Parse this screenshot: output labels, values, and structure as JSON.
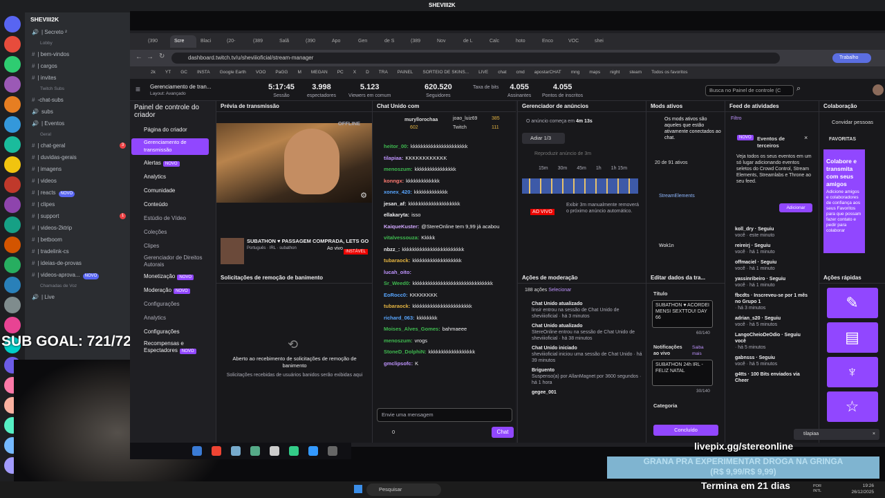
{
  "window_title": "SHEVIII2K",
  "discord": {
    "server_name": "SHEVIII2K",
    "channels": [
      {
        "type": "voice",
        "label": "| Secreto ²"
      },
      {
        "type": "category",
        "label": "Lobby"
      },
      {
        "type": "text",
        "label": "| bem-vindos"
      },
      {
        "type": "text",
        "label": "| cargos"
      },
      {
        "type": "text",
        "label": "| invites"
      },
      {
        "type": "category",
        "label": "Twitch Subs"
      },
      {
        "type": "text",
        "label": "-chat-subs"
      },
      {
        "type": "voice",
        "label": "subs"
      },
      {
        "type": "voice",
        "label": "| Eventos"
      },
      {
        "type": "category",
        "label": "Geral"
      },
      {
        "type": "text",
        "label": "| chat-geral",
        "badge": "3"
      },
      {
        "type": "text",
        "label": "| duvidas-gerais"
      },
      {
        "type": "text",
        "label": "| imagens"
      },
      {
        "type": "text",
        "label": "| videos"
      },
      {
        "type": "text",
        "label": "| reacts",
        "tag": "NOVO"
      },
      {
        "type": "text",
        "label": "| clipes"
      },
      {
        "type": "text",
        "label": "| support",
        "badge": "1"
      },
      {
        "type": "text",
        "label": "| videos-2ktrip"
      },
      {
        "type": "text",
        "label": "| betboom"
      },
      {
        "type": "text",
        "label": "| tradelink-cs"
      },
      {
        "type": "text",
        "label": "| ideias-de-provas"
      },
      {
        "type": "text",
        "label": "| videos-aprova...",
        "tag": "NOVO"
      },
      {
        "type": "category",
        "label": "Chamadas de Voz"
      },
      {
        "type": "voice",
        "label": "| Live"
      }
    ]
  },
  "overlay": {
    "sub_goal": "SUB GOAL: 721/722",
    "livepix": "livepix.gg/stereonline",
    "banner_line1": "GRANA PRA EXPERIMENTAR DROGA NA GRINGA",
    "banner_line2": "(R$ 9,99/R$ 9,99)",
    "countdown": "Termina em 21 dias"
  },
  "browser": {
    "url": "dashboard.twitch.tv/u/sheviiioficial/stream-manager",
    "tabs": [
      "(390",
      "Scre",
      "Blaci",
      "(20-",
      "(389",
      "Salã",
      "(390",
      "Apo",
      "Gen",
      "de S",
      "(389",
      "Nov",
      "de L",
      "Calc",
      "hoto",
      "Enco",
      "VOC",
      "shei"
    ],
    "active_tab": "",
    "bookmarks": [
      "2k",
      "YT",
      "GC",
      "INSTA",
      "Google Earth",
      "VOO",
      "PaGG",
      "M",
      "MEGAN",
      "PC",
      "X",
      "D",
      "TRA",
      "PAINEL",
      "SORTEIO DE SKINS...",
      "LIVE",
      "chat",
      "cmd",
      "apostarCHAT",
      "mng",
      "maps",
      "night",
      "steam",
      "Todos os favoritos"
    ],
    "profile": "Trabalho"
  },
  "twitch_header": {
    "title": "Gerenciamento de tran...",
    "subtitle": "Layout: Avançado",
    "stats": [
      {
        "value": "5:17:45",
        "label": "Sessão"
      },
      {
        "value": "3.998",
        "label": "espectadores"
      },
      {
        "value": "5.123",
        "label": "Viewers em comum"
      },
      {
        "value": "620.520",
        "label": "Seguidores"
      },
      {
        "value": "",
        "label": "Taxa de bits"
      },
      {
        "value": "4.055",
        "label": "Assinantes"
      },
      {
        "value": "4.055",
        "label": "Pontos de inscritos"
      }
    ],
    "search_placeholder": "Busca no Painel de controle (C"
  },
  "sidenav": {
    "title": "Painel de controle do criador",
    "items": [
      {
        "label": "Página do criador"
      },
      {
        "label": "Gerenciamento de transmissão",
        "active": true
      },
      {
        "label": "Alertas",
        "tag": "NOVO"
      },
      {
        "label": "Analytics"
      },
      {
        "label": "Comunidade"
      },
      {
        "label": "Conteúdo"
      },
      {
        "label": "Estúdio de Vídeo",
        "sub": true
      },
      {
        "label": "Coleções",
        "sub": true
      },
      {
        "label": "Clipes",
        "sub": true
      },
      {
        "label": "Gerenciador de Direitos Autorais",
        "sub": true
      },
      {
        "label": "Monetização",
        "tag": "NOVO"
      },
      {
        "label": "Moderação",
        "tag": "NOVO"
      },
      {
        "label": "Configurações",
        "sub": true
      },
      {
        "label": "Analytics",
        "sub": true
      },
      {
        "label": "Configurações"
      },
      {
        "label": "Recompensas e Espectadores",
        "tag": "NOVO"
      }
    ]
  },
  "preview": {
    "header": "Prévia de transmissão",
    "status": "OFFLINE",
    "stream_title": "SUBATHON ♥ PASSAGEM COMPRADA, LETS GO",
    "tags": [
      "Português",
      "IRL",
      "subathon"
    ],
    "ao_vivo": "Ao vivo",
    "instavel": "INSTÁVEL"
  },
  "ban_requests": {
    "header": "Solicitações de remoção de banimento",
    "empty_title": "Aberto ao recebimento de solicitações de remoção de banimento",
    "empty_sub": "Solicitações recebidas de usuários banidos serão exibidas aqui"
  },
  "chat": {
    "header": "Chat Unido com",
    "top_users": [
      {
        "name": "muryllorochaa",
        "value": "602"
      },
      {
        "name": "joao_luiz69",
        "value": "385"
      },
      {
        "name": "Twitch",
        "value": "111"
      }
    ],
    "messages": [
      {
        "user": "heitor_00:",
        "text": "kkkkkkkkkkkkkkkkkkkkkk",
        "color": "#3fb950"
      },
      {
        "user": "tilapiaa:",
        "text": "KKKKKKKKKKKK",
        "color": "#bf94ff"
      },
      {
        "user": "menoszum:",
        "text": "kkkkkkkkkkkkkkkk",
        "color": "#3fb950"
      },
      {
        "user": "konngx:",
        "text": "kkkkkkkkkkkkk",
        "color": "#ff7b72"
      },
      {
        "user": "xonex_420:",
        "text": "kkkkkkkkkkkkk",
        "color": "#58a6ff"
      },
      {
        "user": "jesan_af:",
        "text": "kkkkkkkkkkkkkkkkkkkk",
        "color": "#efeff1"
      },
      {
        "user": "ellakaryta:",
        "text": "isso",
        "color": "#efeff1"
      },
      {
        "user": "KaiqueKuster:",
        "text": "@StereOnline tem 9,99 já acabou",
        "color": "#d2a8ff"
      },
      {
        "user": "vitalvessouza:",
        "text": "Kkkkk",
        "color": "#3fb950"
      },
      {
        "user": "nbzz_:",
        "text": "kkkkkkkkkkkkkkkkkkkkkkkk",
        "color": "#efeff1"
      },
      {
        "user": "tubaraock:",
        "text": "kkkkkkkkkkkkkkkkkkk",
        "color": "#e3b341"
      },
      {
        "user": "lucah_oito:",
        "text": "",
        "color": "#bf94ff"
      },
      {
        "user": "Sr_Weed0:",
        "text": "kkkkkkkkkkkkkkkkkkkkkkkkkkkkkkk",
        "color": "#3fb950"
      },
      {
        "user": "EoRocc0:",
        "text": "KKKKKKKK",
        "color": "#58a6ff"
      },
      {
        "user": "tubaraock:",
        "text": "kkkkkkkkkkkkkkkkkkkkkkk",
        "color": "#e3b341"
      },
      {
        "user": "richard_063:",
        "text": "kkkkkkkk",
        "color": "#58a6ff"
      },
      {
        "user": "Moises_Alves_Gomes:",
        "text": "bahmaeee",
        "color": "#3fb950"
      },
      {
        "user": "menoszum:",
        "text": "vrogs",
        "color": "#3fb950"
      },
      {
        "user": "StoneD_DolphiN:",
        "text": "kkkkkkkkkkkkkkkkkk",
        "color": "#3fb950"
      },
      {
        "user": "gmclipsofc:",
        "text": "K",
        "color": "#bf94ff"
      }
    ],
    "input_placeholder": "Envie uma mensagem",
    "points": "0",
    "send_label": "Chat"
  },
  "ads": {
    "header": "Gerenciador de anúncios",
    "next_ad": "O anúncio começa em",
    "countdown": "4m 13s",
    "snooze": "Adiar 1/3",
    "run_ad": "Reproduzir anúncio de 3m",
    "ticks": [
      "15m",
      "30m",
      "45m",
      "1h",
      "1h 15m"
    ],
    "live_label": "AO VIVO",
    "manual_note": "Exibir 3m manualmente removerá o próximo anúncio automático."
  },
  "mods": {
    "header": "Mods ativos",
    "desc": "Os mods ativos são aqueles que estão ativamente conectados ao chat.",
    "count": "20 de 91 ativos",
    "items": [
      "StreamElements",
      "Wok1n"
    ]
  },
  "activity": {
    "header": "Feed de atividades",
    "filter": "Filtro",
    "promo_title": "Eventos de terceiros",
    "promo_tag": "NOVO",
    "promo_text": "Veja todos os seus eventos em um só lugar adicionando eventos seletos do Crowd Control, Stream Elements, Streamlabs e Throne ao seu feed.",
    "promo_button": "Adicionar",
    "items": [
      {
        "name": "koll_dry · Seguiu",
        "time": "você · este minuto"
      },
      {
        "name": "reireirj · Seguiu",
        "time": "você · há 1 minuto"
      },
      {
        "name": "offmaciel · Seguiu",
        "time": "você · há 1 minuto"
      },
      {
        "name": "yassinribeiro · Seguiu",
        "time": "você · há 1 minuto"
      },
      {
        "name": "fbcdts · Inscreveu-se por 1 mês no Grupo 1",
        "time": "· há 3 minutos"
      },
      {
        "name": "adrian_s20 · Seguiu",
        "time": "você · há 5 minutos"
      },
      {
        "name": "LangoCheioDeOdio · Seguiu você",
        "time": "· há 5 minutos"
      },
      {
        "name": "gabnsss · Seguiu",
        "time": "você · há 5 minutos"
      },
      {
        "name": "g4tts · 100 Bits enviados via Cheer",
        "time": ""
      }
    ]
  },
  "collab": {
    "header": "Colaboração",
    "invite": "Convidar pessoas",
    "favorites": "FAVORITAS",
    "promo_title": "Colabore e transmita com seus amigos",
    "promo_text": "Adicione amigos e colaboradores de confiança aos seus Favoritos para que possam fazer contato e pedir para colaborar"
  },
  "mod_actions": {
    "header": "Ações de moderação",
    "count": "188 ações",
    "select": "Selecionar",
    "items": [
      {
        "title": "Chat Unido atualizado",
        "text": "linsir entrou na sessão de Chat Unido de sheviiioficial · há 3 minutos"
      },
      {
        "title": "Chat Unido atualizado",
        "text": "StereOnline entrou na sessão de Chat Unido de sheviiioficial · há 38 minutos"
      },
      {
        "title": "Chat Unido iniciado",
        "text": "sheviiioficial iniciou uma sessão de Chat Unido · há 39 minutos"
      },
      {
        "title": "Briguento",
        "text": "Suspenso(a) por AllanMagnet por 3600 segundos · há 1 hora"
      },
      {
        "title": "gegee_001",
        "text": ""
      }
    ]
  },
  "edit_stream": {
    "header": "Editar dados da tra...",
    "title_label": "Título",
    "title_value": "SUBATHON ♥ ACORDEI MENSI SEXTTOU! DAY 66",
    "title_count": "60/140",
    "notif_label": "Notificações ao vivo",
    "saiba": "Saiba mais",
    "notif_value": "SUBATHON 24h IRL - FELIZ NATAL",
    "notif_count": "30/140",
    "category_label": "Categoria",
    "done": "Concluído"
  },
  "quick_actions": {
    "header": "Ações rápidas"
  },
  "toast": "tilapiaa",
  "taskbar": {
    "search": "Pesquisar",
    "lang": "POR INTL",
    "time": "19:26",
    "date": "26/12/2025"
  }
}
